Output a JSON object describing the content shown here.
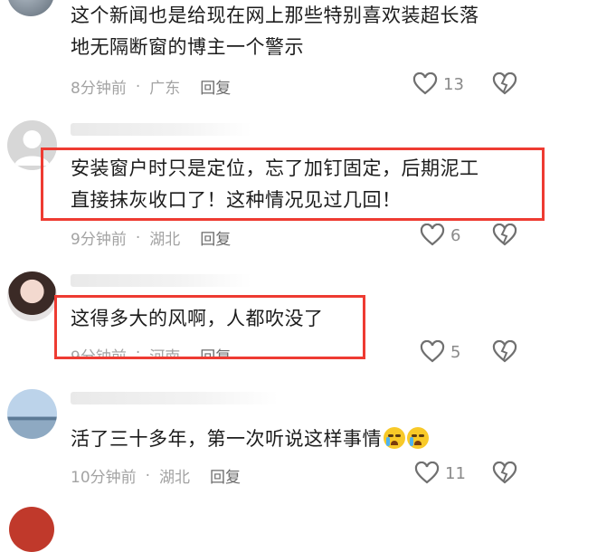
{
  "comments": [
    {
      "lines": [
        "这个新闻也是给现在网上那些特别喜欢装超长落",
        "地无隔断窗的博主一个警示"
      ],
      "time": "8分钟前",
      "location": "广东",
      "reply_label": "回复",
      "likes": "13"
    },
    {
      "lines": [
        "安装窗户时只是定位，忘了加钉固定，后期泥工",
        "直接抹灰收口了！这种情况见过几回！"
      ],
      "time": "9分钟前",
      "location": "湖北",
      "reply_label": "回复",
      "likes": "6"
    },
    {
      "lines": [
        "这得多大的风啊，人都吹没了"
      ],
      "time": "9分钟前",
      "location": "河南",
      "reply_label": "回复",
      "likes": "5"
    },
    {
      "lines": [
        "活了三十多年，第一次听说这样事情"
      ],
      "time": "10分钟前",
      "location": "湖北",
      "reply_label": "回复",
      "likes": "11"
    }
  ],
  "separator": "·",
  "colors": {
    "highlight_box": "#ee3b32",
    "meta_text": "#a3a3a3"
  },
  "icons": {
    "like": "heart-outline-icon",
    "dislike": "broken-heart-icon",
    "emoji": "crying-face-emoji"
  }
}
